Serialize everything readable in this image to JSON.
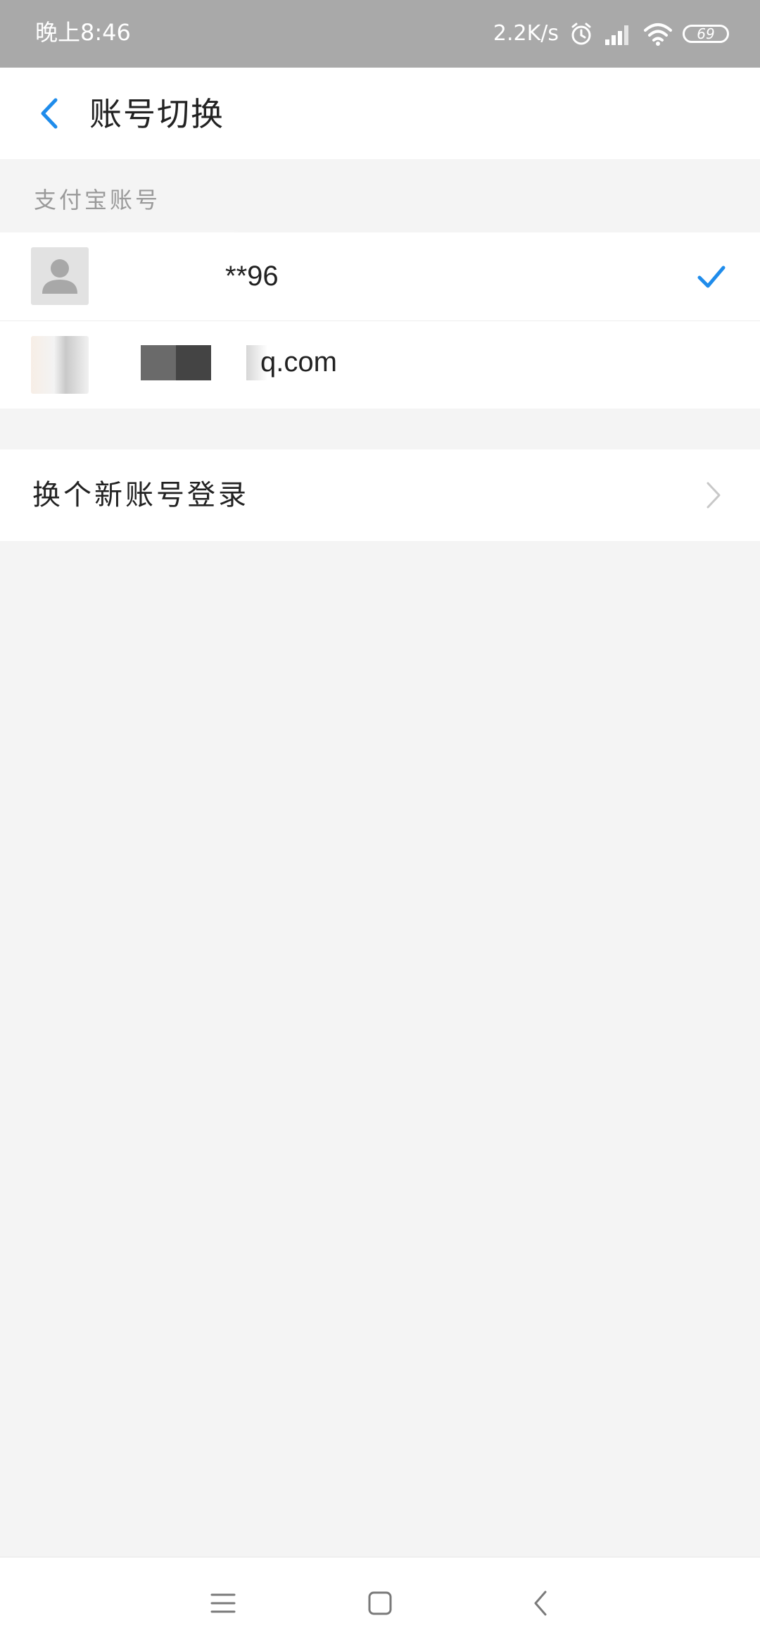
{
  "status_bar": {
    "time": "晚上8:46",
    "net_speed": "2.2K/s",
    "battery": "69",
    "icons": [
      "alarm-icon",
      "signal-icon",
      "wifi-icon",
      "battery-icon"
    ]
  },
  "header": {
    "title": "账号切换",
    "back_icon": "chevron-left-icon"
  },
  "section": {
    "label": "支付宝账号"
  },
  "accounts": [
    {
      "name": "**96",
      "selected": true,
      "avatar": "default-avatar-icon"
    },
    {
      "name": "q.com",
      "selected": false,
      "avatar": "user-photo"
    }
  ],
  "new_account": {
    "label": "换个新账号登录",
    "icon": "chevron-right-icon"
  },
  "nav": {
    "items": [
      "menu-icon",
      "home-icon",
      "back-icon"
    ]
  },
  "colors": {
    "accent": "#1f8ceb",
    "status_bar": "#a9a9a9",
    "background": "#f4f4f4"
  }
}
